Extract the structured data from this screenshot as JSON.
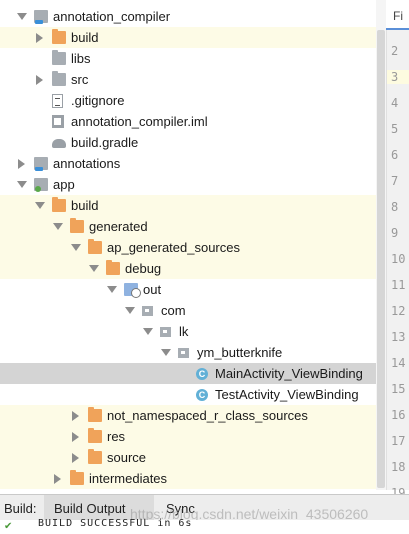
{
  "tree": [
    {
      "label": "annotation_compiler",
      "arrow": "down",
      "icon": "folder-module",
      "icon_name": "module-folder-icon",
      "indent": 0,
      "bg": "white"
    },
    {
      "label": "build",
      "arrow": "right",
      "icon": "folder-orange",
      "icon_name": "build-folder-icon",
      "indent": 1,
      "bg": "yellow"
    },
    {
      "label": "libs",
      "arrow": "",
      "icon": "folder-grey",
      "icon_name": "folder-icon",
      "indent": 1,
      "bg": "white"
    },
    {
      "label": "src",
      "arrow": "right",
      "icon": "folder-grey",
      "icon_name": "folder-icon",
      "indent": 1,
      "bg": "white"
    },
    {
      "label": ".gitignore",
      "arrow": "",
      "icon": "file-lines",
      "icon_name": "text-file-icon",
      "indent": 1,
      "bg": "white"
    },
    {
      "label": "annotation_compiler.iml",
      "arrow": "",
      "icon": "file-iml",
      "icon_name": "iml-file-icon",
      "indent": 1,
      "bg": "white"
    },
    {
      "label": "build.gradle",
      "arrow": "",
      "icon": "gradle",
      "icon_name": "gradle-icon",
      "indent": 1,
      "bg": "white"
    },
    {
      "label": "annotations",
      "arrow": "right",
      "icon": "folder-module",
      "icon_name": "module-folder-icon",
      "indent": 0,
      "bg": "white"
    },
    {
      "label": "app",
      "arrow": "down",
      "icon": "folder-app",
      "icon_name": "android-module-icon",
      "indent": 0,
      "bg": "white"
    },
    {
      "label": "build",
      "arrow": "down",
      "icon": "folder-orange",
      "icon_name": "build-folder-icon",
      "indent": 1,
      "bg": "yellow"
    },
    {
      "label": "generated",
      "arrow": "down",
      "icon": "folder-orange",
      "icon_name": "build-folder-icon",
      "indent": 2,
      "bg": "yellow"
    },
    {
      "label": "ap_generated_sources",
      "arrow": "down",
      "icon": "folder-orange",
      "icon_name": "build-folder-icon",
      "indent": 3,
      "bg": "yellow"
    },
    {
      "label": "debug",
      "arrow": "down",
      "icon": "folder-orange",
      "icon_name": "build-folder-icon",
      "indent": 4,
      "bg": "yellow"
    },
    {
      "label": "out",
      "arrow": "down",
      "icon": "folder-gen",
      "icon_name": "generated-sources-folder-icon",
      "indent": 5,
      "bg": "white"
    },
    {
      "label": "com",
      "arrow": "down",
      "icon": "folder-grey-sm",
      "icon_name": "package-icon",
      "indent": 6,
      "bg": "white"
    },
    {
      "label": "lk",
      "arrow": "down",
      "icon": "folder-grey-sm",
      "icon_name": "package-icon",
      "indent": 7,
      "bg": "white"
    },
    {
      "label": "ym_butterknife",
      "arrow": "down",
      "icon": "folder-grey-sm",
      "icon_name": "package-icon",
      "indent": 8,
      "bg": "white"
    },
    {
      "label": "MainActivity_ViewBinding",
      "arrow": "",
      "icon": "class-icon",
      "icon_name": "class-icon",
      "indent": 9,
      "bg": "selected"
    },
    {
      "label": "TestActivity_ViewBinding",
      "arrow": "",
      "icon": "class-icon",
      "icon_name": "class-icon",
      "indent": 9,
      "bg": "white"
    },
    {
      "label": "not_namespaced_r_class_sources",
      "arrow": "right",
      "icon": "folder-orange",
      "icon_name": "build-folder-icon",
      "indent": 3,
      "bg": "yellow"
    },
    {
      "label": "res",
      "arrow": "right",
      "icon": "folder-orange",
      "icon_name": "build-folder-icon",
      "indent": 3,
      "bg": "yellow"
    },
    {
      "label": "source",
      "arrow": "right",
      "icon": "folder-orange",
      "icon_name": "build-folder-icon",
      "indent": 3,
      "bg": "yellow"
    },
    {
      "label": "intermediates",
      "arrow": "right",
      "icon": "folder-orange",
      "icon_name": "build-folder-icon",
      "indent": 2,
      "bg": "yellow"
    }
  ],
  "editor": {
    "tab_label": "Fi",
    "line_numbers": [
      "2",
      "3",
      "4",
      "5",
      "6",
      "7",
      "8",
      "9",
      "10",
      "11",
      "12",
      "13",
      "14",
      "15",
      "16",
      "17",
      "18",
      "19"
    ],
    "current_line": "3"
  },
  "build_bar": {
    "label": "Build:",
    "tab_output": "Build Output",
    "tab_sync": "Sync"
  },
  "console": {
    "text": "BUILD SUCCESSFUL in 6s"
  },
  "watermark": "https://blog.csdn.net/weixin_43506260"
}
